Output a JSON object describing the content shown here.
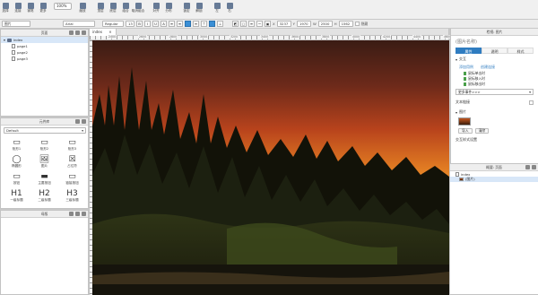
{
  "toolbar": {
    "buttons": [
      "选择",
      "连接",
      "钢笔",
      "更多",
      "缩放",
      "顶层",
      "底层",
      "组合",
      "取消组合",
      "对齐",
      "分布",
      "锁定",
      "解锁",
      "左",
      "右"
    ],
    "zoom": "100%"
  },
  "format_bar": {
    "widget_type": "图片",
    "font": "Arial",
    "style": "Regular",
    "size": "13",
    "x_label": "X",
    "x": "3237",
    "y_label": "Y",
    "y": "1970",
    "w_label": "W",
    "w": "2500",
    "h_label": "H",
    "h": "1562",
    "hidden_label": "隐藏"
  },
  "pages_panel": {
    "title": "页面",
    "items": [
      "index",
      "page1",
      "page2",
      "page3"
    ]
  },
  "library_panel": {
    "title": "元件库",
    "library": "Default",
    "widgets": [
      {
        "label": "矩形1",
        "glyph": "▭"
      },
      {
        "label": "矩形2",
        "glyph": "▭"
      },
      {
        "label": "矩形3",
        "glyph": "▭"
      },
      {
        "label": "椭圆形",
        "glyph": "◯"
      },
      {
        "label": "图片",
        "glyph": "🖼"
      },
      {
        "label": "占位符",
        "glyph": "☒"
      },
      {
        "label": "按钮",
        "glyph": "▭"
      },
      {
        "label": "主要按钮",
        "glyph": "▬"
      },
      {
        "label": "链接按钮",
        "glyph": "▭"
      },
      {
        "label": "一级标题",
        "glyph": "H1"
      },
      {
        "label": "二级标题",
        "glyph": "H2"
      },
      {
        "label": "三级标题",
        "glyph": "H3"
      }
    ]
  },
  "masters_panel": {
    "title": "母版"
  },
  "canvas": {
    "tab": "index",
    "ruler_labels": [
      "2400",
      "2600",
      "2800",
      "3000",
      "3200",
      "3400",
      "3600",
      "3800",
      "4000",
      "4200",
      "4400",
      "4600"
    ]
  },
  "inspector": {
    "title": "检视: 图片",
    "widget_name": "(图片名称)",
    "tabs": [
      "属性",
      "说明",
      "样式"
    ],
    "interaction_label": "交互",
    "add_case": "添加用例",
    "create_link": "创建连接",
    "events": [
      "鼠标单击时",
      "鼠标移入时",
      "鼠标移出时"
    ],
    "more_events": "更多事件>>>",
    "text_link": "文本链接",
    "image_label": "图片",
    "import_btn": "导入",
    "clear_btn": "清除",
    "interaction_style": "交互样式设置"
  },
  "outline": {
    "title": "概要: 页面",
    "items": [
      "index",
      "(图片)"
    ]
  }
}
